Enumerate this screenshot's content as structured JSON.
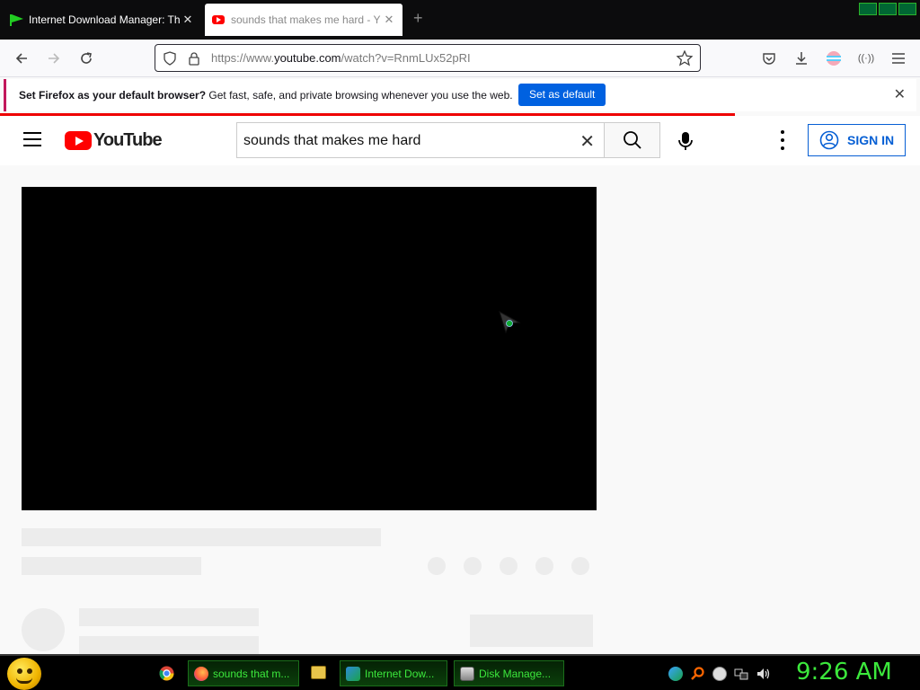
{
  "browser": {
    "tabs": [
      {
        "title": "Internet Download Manager: Th",
        "active": false
      },
      {
        "title": "sounds that makes me hard - Y",
        "active": true
      }
    ],
    "url_prefix": "https://www.",
    "url_domain": "youtube.com",
    "url_path": "/watch?v=RnmLUx52pRI",
    "notification": {
      "bold_text": "Set Firefox as your default browser?",
      "text": " Get fast, safe, and private browsing whenever you use the web.",
      "button_label": "Set as default"
    }
  },
  "youtube": {
    "logo_text": "YouTube",
    "search_query": "sounds that makes me hard",
    "sign_in_label": "SIGN IN"
  },
  "taskbar": {
    "items": [
      {
        "label": "sounds that m...",
        "icon": "firefox-icon"
      },
      {
        "label": "Internet Dow...",
        "icon": "idm-icon"
      },
      {
        "label": "Disk Manage...",
        "icon": "disk-icon"
      }
    ],
    "clock": "9:26 AM"
  },
  "colors": {
    "youtube_red": "#ff0000",
    "firefox_blue": "#0061e0",
    "taskbar_green": "#3ce83c"
  }
}
